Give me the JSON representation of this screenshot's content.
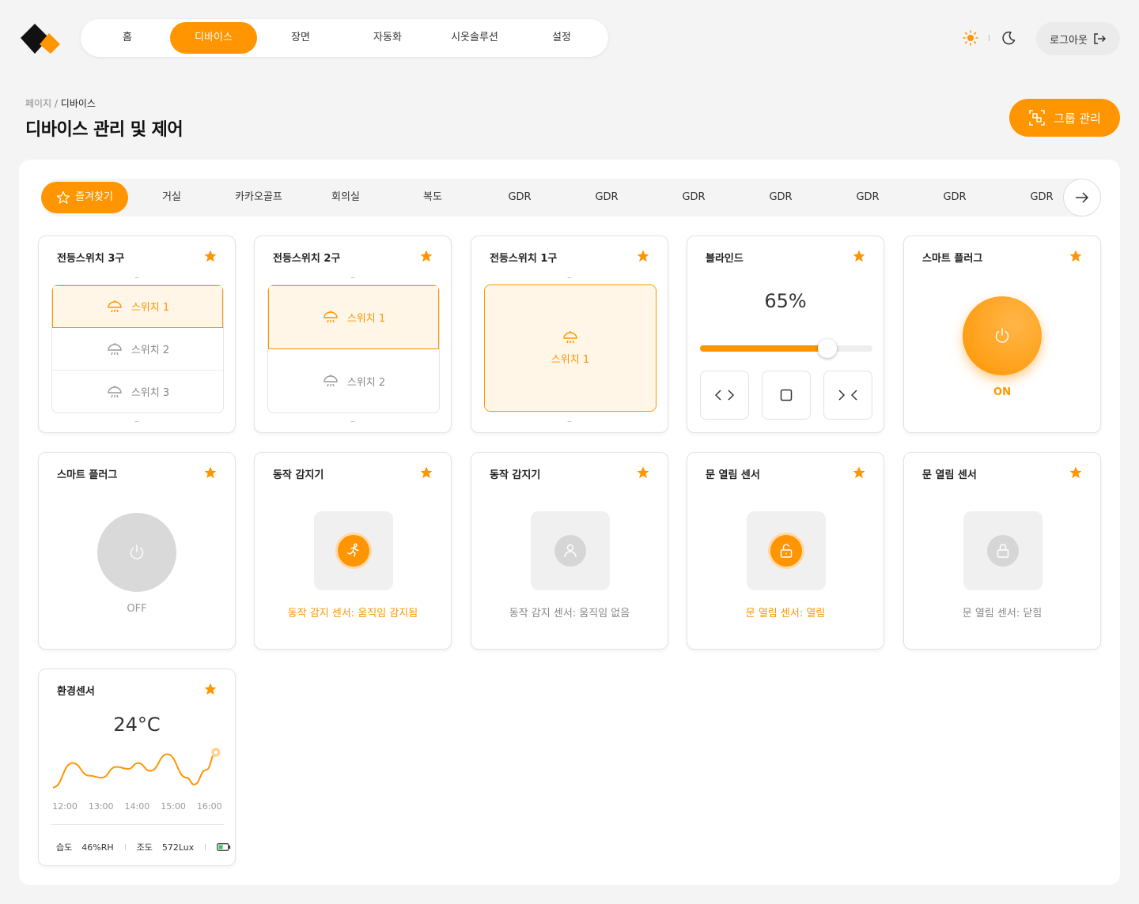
{
  "colors": {
    "accent": "#ff9500",
    "off": "#d9d9d9"
  },
  "nav": {
    "items": [
      "홈",
      "디바이스",
      "장면",
      "자동화",
      "시옷솔루션",
      "설정"
    ],
    "active": 1
  },
  "header": {
    "logout_label": "로그아웃",
    "theme_icons": [
      "sun-icon",
      "moon-icon"
    ]
  },
  "breadcrumb": {
    "parent": "페이지 / ",
    "current": "디바이스"
  },
  "page_title": "디바이스 관리 및 제어",
  "group_button": "그룹 관리",
  "tabs": {
    "items": [
      "즐겨찾기",
      "거실",
      "카카오골프",
      "회의실",
      "복도",
      "GDR",
      "GDR",
      "GDR",
      "GDR",
      "GDR",
      "GDR",
      "GDR"
    ],
    "active": 0
  },
  "cards": {
    "switch3": {
      "title": "전등스위치 3구",
      "dash": "–",
      "switches": [
        {
          "label": "스위치 1",
          "on": true
        },
        {
          "label": "스위치 2",
          "on": false
        },
        {
          "label": "스위치 3",
          "on": false
        }
      ]
    },
    "switch2": {
      "title": "전등스위치 2구",
      "dash": "–",
      "switches": [
        {
          "label": "스위치 1",
          "on": true
        },
        {
          "label": "스위치 2",
          "on": false
        }
      ]
    },
    "switch1": {
      "title": "전등스위치 1구",
      "dash": "–",
      "switches": [
        {
          "label": "스위치 1",
          "on": true
        }
      ]
    },
    "blind": {
      "title": "블라인드",
      "value_label": "65%",
      "level": 0.74
    },
    "plug_on": {
      "title": "스마트 플러그",
      "state": "ON"
    },
    "plug_off": {
      "title": "스마트 플러그",
      "state": "OFF"
    },
    "motion_on": {
      "title": "동작 감지기",
      "status": "동작 감지 센서: 움직임 감지됨"
    },
    "motion_off": {
      "title": "동작 감지기",
      "status": "동작 감지 센서: 움직임 없음"
    },
    "door_open": {
      "title": "문 열림 센서",
      "status": "문 열림 센서: 열림"
    },
    "door_closed": {
      "title": "문 열림 센서",
      "status": "문 열림 센서: 닫힘"
    },
    "env": {
      "title": "환경센서",
      "temperature": "24°C",
      "humidity_label": "습도",
      "humidity": "46%RH",
      "illum_label": "조도",
      "illum": "572Lux"
    }
  },
  "chart_data": {
    "type": "line",
    "x": [
      "12:00",
      "13:00",
      "14:00",
      "15:00",
      "16:00"
    ],
    "xlabel": "",
    "ylabel": "",
    "points": [
      [
        0,
        0
      ],
      [
        0.4,
        2.5
      ],
      [
        0.75,
        1.2
      ],
      [
        1.0,
        1.0
      ],
      [
        1.3,
        2.1
      ],
      [
        1.55,
        1.9
      ],
      [
        1.75,
        2.5
      ],
      [
        2.0,
        1.7
      ],
      [
        2.35,
        3.4
      ],
      [
        2.75,
        1.0
      ],
      [
        2.9,
        0.3
      ],
      [
        3.15,
        1.8
      ],
      [
        3.35,
        3.6
      ]
    ],
    "yrange": [
      -0.2,
      4
    ]
  }
}
